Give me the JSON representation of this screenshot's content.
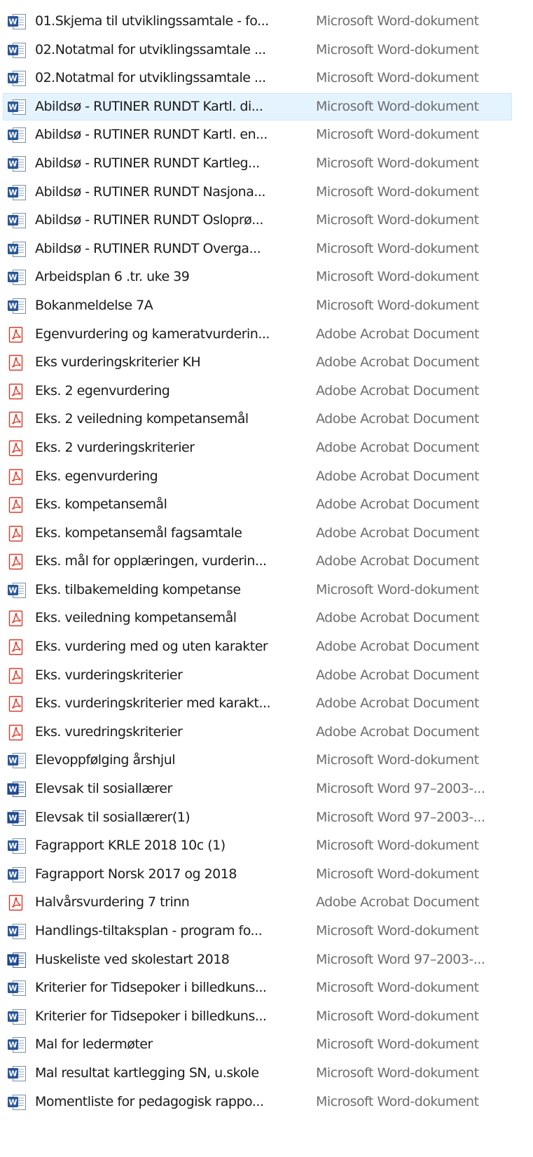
{
  "files": [
    {
      "name": "01.Skjema til utviklingssamtale - fo...",
      "type": "Microsoft Word-dokument",
      "icon": "word-docx-icon"
    },
    {
      "name": "02.Notatmal for utviklingssamtale ...",
      "type": "Microsoft Word-dokument",
      "icon": "word-docx-icon"
    },
    {
      "name": "02.Notatmal for utviklingssamtale ...",
      "type": "Microsoft Word-dokument",
      "icon": "word-docx-icon"
    },
    {
      "name": "Abildsø - RUTINER RUNDT Kartl. di...",
      "type": "Microsoft Word-dokument",
      "icon": "word-docx-icon",
      "selected": true
    },
    {
      "name": "Abildsø - RUTINER RUNDT Kartl. en...",
      "type": "Microsoft Word-dokument",
      "icon": "word-docx-icon"
    },
    {
      "name": "Abildsø - RUTINER RUNDT Kartleg...",
      "type": "Microsoft Word-dokument",
      "icon": "word-docx-icon"
    },
    {
      "name": "Abildsø - RUTINER RUNDT Nasjona...",
      "type": "Microsoft Word-dokument",
      "icon": "word-docx-icon"
    },
    {
      "name": "Abildsø - RUTINER RUNDT Osloprø...",
      "type": "Microsoft Word-dokument",
      "icon": "word-docx-icon"
    },
    {
      "name": "Abildsø - RUTINER RUNDT Overga...",
      "type": "Microsoft Word-dokument",
      "icon": "word-docx-icon"
    },
    {
      "name": "Arbeidsplan 6 .tr. uke 39",
      "type": "Microsoft Word-dokument",
      "icon": "word-docx-icon"
    },
    {
      "name": "Bokanmeldelse 7A",
      "type": "Microsoft Word-dokument",
      "icon": "word-docx-icon"
    },
    {
      "name": "Egenvurdering og kameratvurderin...",
      "type": "Adobe Acrobat Document",
      "icon": "pdf-icon"
    },
    {
      "name": "Eks vurderingskriterier KH",
      "type": "Adobe Acrobat Document",
      "icon": "pdf-icon"
    },
    {
      "name": "Eks. 2 egenvurdering",
      "type": "Adobe Acrobat Document",
      "icon": "pdf-icon"
    },
    {
      "name": "Eks. 2 veiledning kompetansemål",
      "type": "Adobe Acrobat Document",
      "icon": "pdf-icon"
    },
    {
      "name": "Eks. 2 vurderingskriterier",
      "type": "Adobe Acrobat Document",
      "icon": "pdf-icon"
    },
    {
      "name": "Eks. egenvurdering",
      "type": "Adobe Acrobat Document",
      "icon": "pdf-icon"
    },
    {
      "name": "Eks. kompetansemål",
      "type": "Adobe Acrobat Document",
      "icon": "pdf-icon"
    },
    {
      "name": "Eks. kompetansemål fagsamtale",
      "type": "Adobe Acrobat Document",
      "icon": "pdf-icon"
    },
    {
      "name": "Eks. mål for opplæringen, vurderin...",
      "type": "Adobe Acrobat Document",
      "icon": "pdf-icon"
    },
    {
      "name": "Eks. tilbakemelding kompetanse",
      "type": "Microsoft Word-dokument",
      "icon": "word-docx-icon"
    },
    {
      "name": "Eks. veiledning kompetansemål",
      "type": "Adobe Acrobat Document",
      "icon": "pdf-icon"
    },
    {
      "name": "Eks. vurdering med og uten karakter",
      "type": "Adobe Acrobat Document",
      "icon": "pdf-icon"
    },
    {
      "name": "Eks. vurderingskriterier",
      "type": "Adobe Acrobat Document",
      "icon": "pdf-icon"
    },
    {
      "name": "Eks. vurderingskriterier med karakt...",
      "type": "Adobe Acrobat Document",
      "icon": "pdf-icon"
    },
    {
      "name": "Eks. vuredringskriterier",
      "type": "Adobe Acrobat Document",
      "icon": "pdf-icon"
    },
    {
      "name": "Elevoppfølging årshjul",
      "type": "Microsoft Word-dokument",
      "icon": "word-docx-icon"
    },
    {
      "name": "Elevsak til sosiallærer",
      "type": "Microsoft Word 97–2003-...",
      "icon": "word-doc-icon"
    },
    {
      "name": "Elevsak til sosiallærer(1)",
      "type": "Microsoft Word 97–2003-...",
      "icon": "word-doc-icon"
    },
    {
      "name": "Fagrapport KRLE 2018 10c (1)",
      "type": "Microsoft Word-dokument",
      "icon": "word-docx-icon"
    },
    {
      "name": "Fagrapport Norsk 2017 og 2018",
      "type": "Microsoft Word-dokument",
      "icon": "word-docx-icon"
    },
    {
      "name": "Halvårsvurdering 7 trinn",
      "type": "Adobe Acrobat Document",
      "icon": "pdf-icon"
    },
    {
      "name": "Handlings-tiltaksplan - program fo...",
      "type": "Microsoft Word-dokument",
      "icon": "word-docx-icon"
    },
    {
      "name": "Huskeliste ved skolestart 2018",
      "type": "Microsoft Word 97–2003-...",
      "icon": "word-doc-icon"
    },
    {
      "name": "Kriterier for Tidsepoker i billedkuns...",
      "type": "Microsoft Word-dokument",
      "icon": "word-docx-icon"
    },
    {
      "name": "Kriterier for Tidsepoker i billedkuns...",
      "type": "Microsoft Word-dokument",
      "icon": "word-docx-icon"
    },
    {
      "name": "Mal for ledermøter",
      "type": "Microsoft Word-dokument",
      "icon": "word-docx-icon"
    },
    {
      "name": "Mal resultat kartlegging SN, u.skole",
      "type": "Microsoft Word-dokument",
      "icon": "word-docx-icon"
    },
    {
      "name": "Momentliste for pedagogisk rappo...",
      "type": "Microsoft Word-dokument",
      "icon": "word-docx-icon"
    }
  ],
  "colors": {
    "selection_bg": "#e5f3ff",
    "selection_border": "#cce8ff",
    "type_text": "#6d6d6d",
    "word_blue": "#2b5797",
    "pdf_red": "#d83b2c"
  }
}
